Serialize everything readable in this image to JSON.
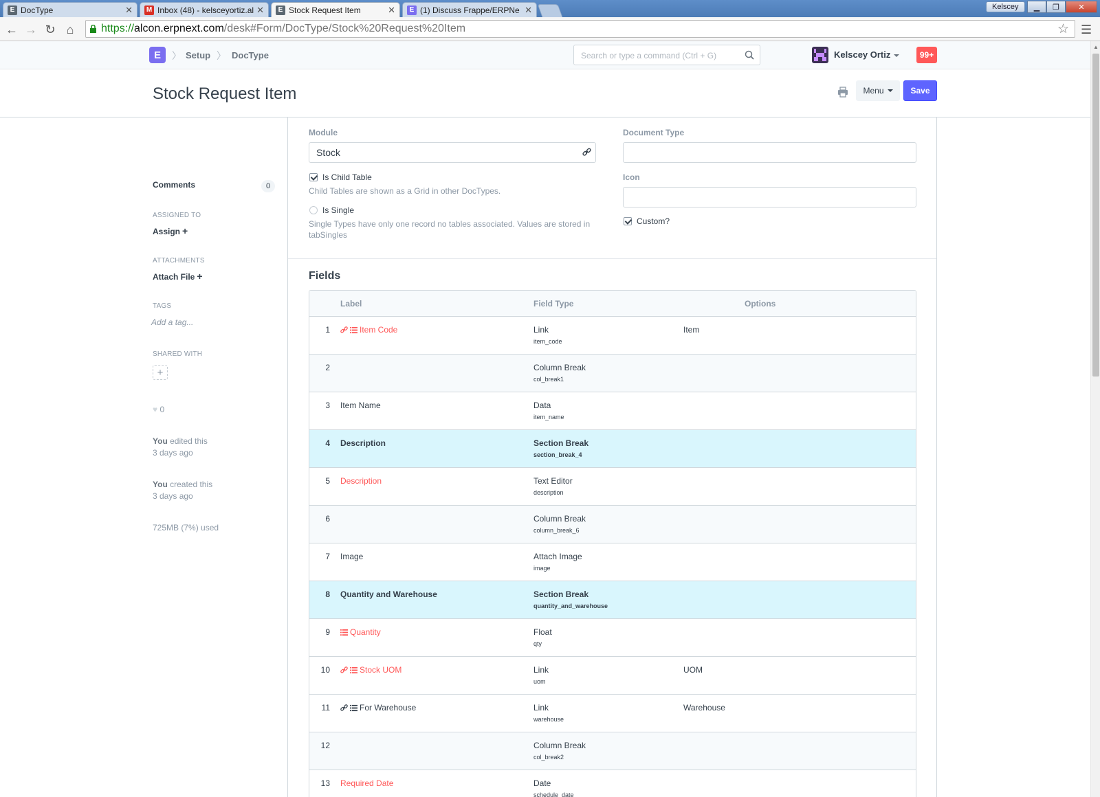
{
  "browser": {
    "tabs": [
      {
        "label": "DocType",
        "favicon": "E",
        "favicon_color": "#5b6771",
        "active": false
      },
      {
        "label": "Inbox (48) - kelsceyortiz.al",
        "favicon": "M",
        "favicon_color": "#d93025",
        "active": false
      },
      {
        "label": "Stock Request Item",
        "favicon": "E",
        "favicon_color": "#5b6771",
        "active": true
      },
      {
        "label": "(1) Discuss Frappe/ERPNe",
        "favicon": "E",
        "favicon_color": "#7a6ef0",
        "active": false
      }
    ],
    "profile_chip": "Kelscey",
    "url_proto": "https://",
    "url_host": "alcon.erpnext.com",
    "url_path": "/desk#Form/DocType/Stock%20Request%20Item"
  },
  "navbar": {
    "logo": "E",
    "breadcrumbs": [
      "Setup",
      "DocType"
    ],
    "search_placeholder": "Search or type a command (Ctrl + G)",
    "user_name": "Kelscey Ortiz",
    "notification_count": "99+"
  },
  "title_bar": {
    "title": "Stock Request Item",
    "menu_label": "Menu",
    "save_label": "Save"
  },
  "sidebar": {
    "comments_label": "Comments",
    "comments_count": "0",
    "assigned_heading": "ASSIGNED TO",
    "assign_label": "Assign",
    "attachments_heading": "ATTACHMENTS",
    "attach_label": "Attach File",
    "tags_heading": "TAGS",
    "add_tag": "Add a tag...",
    "shared_heading": "SHARED WITH",
    "likes": "0",
    "edited_by": "You",
    "edited_text": " edited this",
    "edited_when": "3 days ago",
    "created_by": "You",
    "created_text": " created this",
    "created_when": "3 days ago",
    "usage": "725MB (7%) used"
  },
  "form": {
    "module_label": "Module",
    "module_value": "Stock",
    "doctype_label": "Document Type",
    "doctype_value": "",
    "icon_label": "Icon",
    "icon_value": "",
    "is_child_label": "Is Child Table",
    "is_child_help": "Child Tables are shown as a Grid in other DocTypes.",
    "is_single_label": "Is Single",
    "is_single_help_1": "Single Types have only one record no tables associated. Values are stored in",
    "is_single_help_2": "tabSingles",
    "custom_label": "Custom?"
  },
  "fields": {
    "heading": "Fields",
    "columns": [
      "Label",
      "Field Type",
      "Options"
    ],
    "rows": [
      {
        "idx": "1",
        "label": "Item Code",
        "type": "Link",
        "fieldname": "item_code",
        "options": "Item",
        "required": true,
        "icons": [
          "link",
          "list"
        ],
        "kind": "normal"
      },
      {
        "idx": "2",
        "label": "",
        "type": "Column Break",
        "fieldname": "col_break1",
        "options": "",
        "required": false,
        "icons": [],
        "kind": "alt"
      },
      {
        "idx": "3",
        "label": "Item Name",
        "type": "Data",
        "fieldname": "item_name",
        "options": "",
        "required": false,
        "icons": [],
        "kind": "normal"
      },
      {
        "idx": "4",
        "label": "Description",
        "type": "Section Break",
        "fieldname": "section_break_4",
        "options": "",
        "required": false,
        "icons": [],
        "kind": "section"
      },
      {
        "idx": "5",
        "label": "Description",
        "type": "Text Editor",
        "fieldname": "description",
        "options": "",
        "required": true,
        "icons": [],
        "kind": "normal"
      },
      {
        "idx": "6",
        "label": "",
        "type": "Column Break",
        "fieldname": "column_break_6",
        "options": "",
        "required": false,
        "icons": [],
        "kind": "alt"
      },
      {
        "idx": "7",
        "label": "Image",
        "type": "Attach Image",
        "fieldname": "image",
        "options": "",
        "required": false,
        "icons": [],
        "kind": "normal"
      },
      {
        "idx": "8",
        "label": "Quantity and Warehouse",
        "type": "Section Break",
        "fieldname": "quantity_and_warehouse",
        "options": "",
        "required": false,
        "icons": [],
        "kind": "section"
      },
      {
        "idx": "9",
        "label": "Quantity",
        "type": "Float",
        "fieldname": "qty",
        "options": "",
        "required": true,
        "icons": [
          "list"
        ],
        "kind": "normal"
      },
      {
        "idx": "10",
        "label": "Stock UOM",
        "type": "Link",
        "fieldname": "uom",
        "options": "UOM",
        "required": true,
        "icons": [
          "link",
          "list"
        ],
        "kind": "normal"
      },
      {
        "idx": "11",
        "label": "For Warehouse",
        "type": "Link",
        "fieldname": "warehouse",
        "options": "Warehouse",
        "required": false,
        "icons": [
          "link",
          "list"
        ],
        "kind": "normal"
      },
      {
        "idx": "12",
        "label": "",
        "type": "Column Break",
        "fieldname": "col_break2",
        "options": "",
        "required": false,
        "icons": [],
        "kind": "alt"
      },
      {
        "idx": "13",
        "label": "Required Date",
        "type": "Date",
        "fieldname": "schedule_date",
        "options": "",
        "required": true,
        "icons": [],
        "kind": "normal"
      }
    ]
  },
  "colors": {
    "primary": "#5e64ff",
    "required": "#ff5858",
    "section_row": "#d9f6fd",
    "muted": "#8d99a6"
  }
}
